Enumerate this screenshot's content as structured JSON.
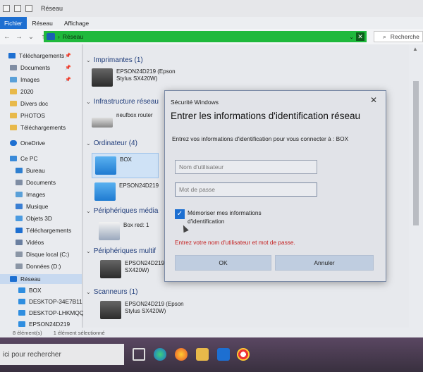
{
  "window": {
    "title": "Réseau"
  },
  "ribbon": {
    "tabs": [
      "Fichier",
      "Réseau",
      "Affichage"
    ]
  },
  "address": {
    "crumb": "Réseau",
    "search_placeholder": "Recherche"
  },
  "sidebar": {
    "items": [
      {
        "label": "Téléchargements",
        "icon": "download-icon",
        "pinned": true
      },
      {
        "label": "Documents",
        "icon": "documents-icon",
        "pinned": true
      },
      {
        "label": "Images",
        "icon": "images-icon",
        "pinned": true
      },
      {
        "label": "2020",
        "icon": "folder-icon"
      },
      {
        "label": "Divers doc",
        "icon": "folder-icon"
      },
      {
        "label": "PHOTOS",
        "icon": "folder-icon"
      },
      {
        "label": "Téléchargements",
        "icon": "folder-icon"
      },
      {
        "label": "OneDrive",
        "icon": "cloud-icon"
      },
      {
        "label": "Ce PC",
        "icon": "computer-icon"
      },
      {
        "label": "Bureau",
        "icon": "desktop-icon"
      },
      {
        "label": "Documents",
        "icon": "documents-icon"
      },
      {
        "label": "Images",
        "icon": "images-icon"
      },
      {
        "label": "Musique",
        "icon": "music-icon"
      },
      {
        "label": "Objets 3D",
        "icon": "cube-icon"
      },
      {
        "label": "Téléchargements",
        "icon": "download-icon"
      },
      {
        "label": "Vidéos",
        "icon": "video-icon"
      },
      {
        "label": "Disque local (C:)",
        "icon": "drive-icon"
      },
      {
        "label": "Données (D:)",
        "icon": "drive-icon"
      },
      {
        "label": "Réseau",
        "icon": "network-icon"
      },
      {
        "label": "BOX",
        "icon": "computer-icon"
      },
      {
        "label": "DESKTOP-34E7B11",
        "icon": "computer-icon"
      },
      {
        "label": "DESKTOP-LHKMQQ(",
        "icon": "computer-icon"
      },
      {
        "label": "EPSON24D219",
        "icon": "computer-icon"
      }
    ]
  },
  "content": {
    "groups": [
      {
        "header": "Imprimantes (1)",
        "devices": [
          "EPSON24D219 (Epson Stylus SX420W)"
        ]
      },
      {
        "header": "Infrastructure réseau",
        "devices": [
          "neufbox router"
        ]
      },
      {
        "header": "Ordinateur (4)",
        "devices": [
          "BOX",
          "EPSON24D219"
        ]
      },
      {
        "header": "Périphériques média",
        "devices": [
          "Box red: 1"
        ]
      },
      {
        "header": "Périphériques multif",
        "devices": [
          "EPSON24D219 (E SX420W)"
        ]
      },
      {
        "header": "Scanneurs (1)",
        "devices": [
          "EPSON24D219 (Epson Stylus SX420W)"
        ]
      }
    ]
  },
  "status": {
    "count": "8 élément(s)",
    "selection": "1 élément sélectionné"
  },
  "taskbar": {
    "search_placeholder": "ici pour rechercher"
  },
  "dialog": {
    "title": "Sécurité Windows",
    "heading": "Entrer les informations d'identification réseau",
    "description": "Entrez vos informations d'identification pour vous connecter à : BOX",
    "username_placeholder": "Nom d'utilisateur",
    "password_placeholder": "Mot de passe",
    "remember_label": "Mémoriser mes informations d'identification",
    "remember_checked": true,
    "error": "Entrez votre nom d'utilisateur et mot de passe.",
    "ok_label": "OK",
    "cancel_label": "Annuler"
  },
  "colors": {
    "accent": "#1d6fd1",
    "address_bar": "#1fb93c",
    "error": "#c42020"
  }
}
